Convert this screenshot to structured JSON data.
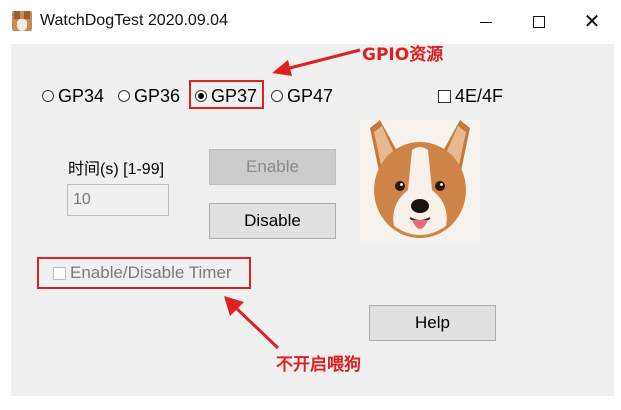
{
  "window": {
    "title": "WatchDogTest 2020.09.04",
    "controls": {
      "minimize": "—",
      "maximize": "□",
      "close": "✕"
    }
  },
  "gpio": {
    "options": [
      {
        "label": "GP34",
        "selected": false
      },
      {
        "label": "GP36",
        "selected": false
      },
      {
        "label": "GP37",
        "selected": true
      },
      {
        "label": "GP47",
        "selected": false
      }
    ],
    "checkbox_4e4f": {
      "label": "4E/4F",
      "checked": false
    }
  },
  "time": {
    "label_cn": "时间",
    "label_rest": "(s) [1-99]",
    "value": "10"
  },
  "buttons": {
    "enable": "Enable",
    "disable": "Disable",
    "help": "Help"
  },
  "timer_checkbox": {
    "label": "Enable/Disable Timer",
    "checked": false,
    "disabled": true
  },
  "annotations": {
    "gpio": "GPIO资源",
    "feed": "不开启喂狗",
    "color": "#e02020"
  }
}
